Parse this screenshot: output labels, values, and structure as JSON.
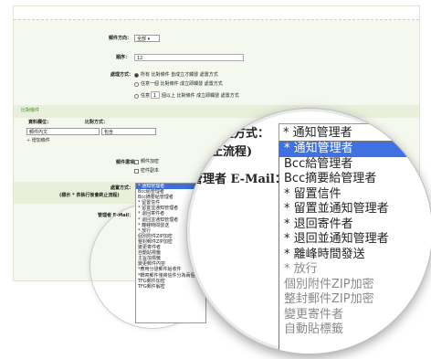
{
  "form": {
    "direction_label": "郵件方向：",
    "direction_value": "全部",
    "order_label": "順序：",
    "order_value": "12",
    "mode_label": "處理方式：",
    "mode_options": [
      {
        "text": "所有 比對條件 皆成立才觸發 處置方式",
        "checked": true
      },
      {
        "text": "任意一個 比對條件 成立即觸發 處置方式",
        "checked": false
      },
      {
        "text_before": "任意",
        "count": "1",
        "text_after": "個以上 比對條件 成立即觸發 處置方式",
        "checked": false
      }
    ],
    "compare_header": "比對條件",
    "field_label": "資料欄位：",
    "field_value": "郵件內文",
    "method_label": "比對方式：",
    "method_value": "包含",
    "add_condition": "增加條件",
    "options_label": "郵件選項：",
    "options": [
      "郵件加密",
      "密件副本"
    ],
    "action_label": "處置方式：",
    "action_note": "(標示 * 表執行後會終止流程)",
    "admin_email_label": "管理者 E-Mail：",
    "action_value": "* 通知管理者"
  },
  "action_list": {
    "items": [
      {
        "text": "* 通知管理者",
        "highlight": true,
        "gray": false
      },
      {
        "text": "Bcc給管理者",
        "highlight": false,
        "gray": false
      },
      {
        "text": "Bcc摘要給管理者",
        "highlight": false,
        "gray": false
      },
      {
        "text": "* 留置信件",
        "highlight": false,
        "gray": false
      },
      {
        "text": "* 留置並通知管理者",
        "highlight": false,
        "gray": false
      },
      {
        "text": "* 退回寄件者",
        "highlight": false,
        "gray": false
      },
      {
        "text": "* 退回並通知管理者",
        "highlight": false,
        "gray": false
      },
      {
        "text": "* 離峰時間發送",
        "highlight": false,
        "gray": false
      },
      {
        "text": "* 放行",
        "highlight": false,
        "gray": true
      },
      {
        "text": "個別附件ZIP加密",
        "highlight": false,
        "gray": true
      },
      {
        "text": "整封郵件ZIP加密",
        "highlight": false,
        "gray": true
      },
      {
        "text": "變更寄件者",
        "highlight": false,
        "gray": true
      },
      {
        "text": "自動貼標籤",
        "highlight": false,
        "gray": true
      }
    ],
    "extra_small_items": [
      "主旨加標籤",
      "變更郵件內容",
      "*應用分發郵件給收件",
      "*轉寄郵件僅將信件分為兩個",
      "TFG郵件加密",
      "TFG郵件解密"
    ]
  },
  "magnifier": {
    "method_label": "置方式：",
    "note": "(標示 * 表執行後會終止流程)",
    "admin_label": "管理者 E-Mail：",
    "select_value": "* 通知管理者"
  }
}
